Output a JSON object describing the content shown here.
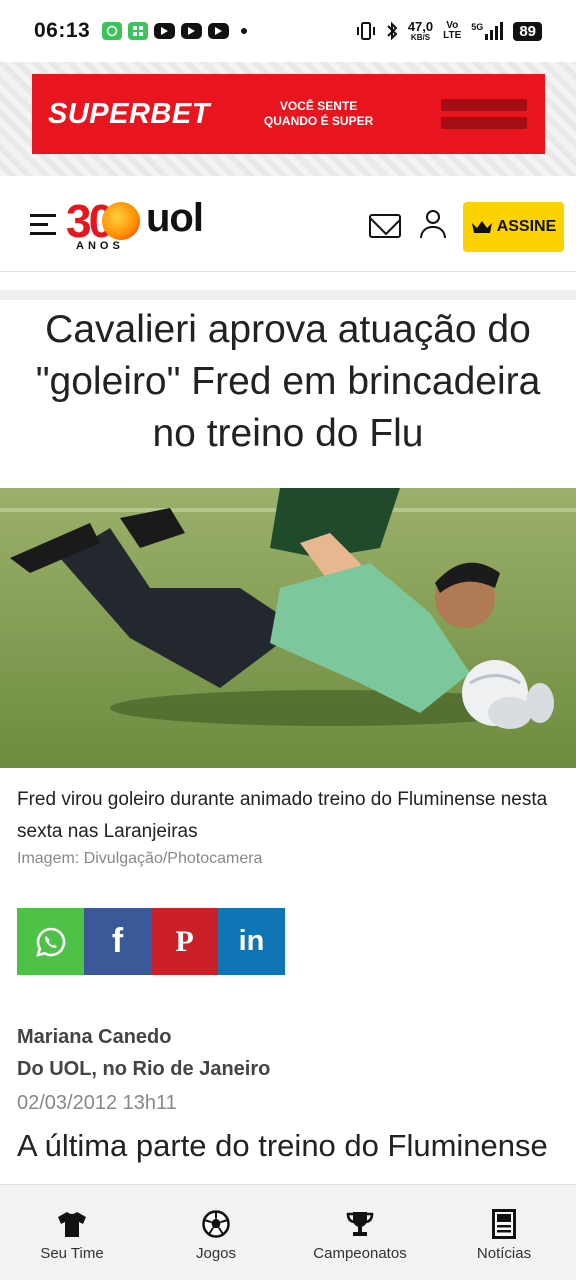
{
  "status_bar": {
    "time": "06:13",
    "speed_value": "47,0",
    "speed_unit": "KB/S",
    "network_top": "Vo",
    "network_bottom": "LTE",
    "signal_label": "5G",
    "battery": "89"
  },
  "ad": {
    "brand": "SUPERBET",
    "tagline_line1": "VOCÊ SENTE",
    "tagline_line2": "QUANDO É SUPER"
  },
  "header": {
    "logo_number": "30",
    "logo_brand": "uol",
    "logo_sub": "ANOS",
    "subscribe_label": "ASSINE"
  },
  "article": {
    "headline": "Cavalieri aprova atuação do \"goleiro\" Fred em brincadeira no treino do Flu",
    "caption": "Fred virou goleiro durante animado treino do Fluminense nesta sexta nas Laranjeiras",
    "credit": "Imagem: Divulgação/Photocamera",
    "author": "Mariana Canedo",
    "source": "Do UOL, no Rio de Janeiro",
    "date": "02/03/2012  13h11",
    "body_start": "A última parte do treino do Fluminense"
  },
  "share": [
    "whatsapp-icon",
    "facebook-icon",
    "pinterest-icon",
    "linkedin-icon"
  ],
  "bottom_nav": {
    "items": [
      {
        "label": "Seu Time",
        "icon": "shirt-icon"
      },
      {
        "label": "Jogos",
        "icon": "soccer-ball-icon"
      },
      {
        "label": "Campeonatos",
        "icon": "trophy-icon"
      },
      {
        "label": "Notícias",
        "icon": "newspaper-icon"
      }
    ]
  },
  "colors": {
    "ad_red": "#e8141e",
    "subscribe_yellow": "#fcd200",
    "whatsapp": "#4dc247",
    "facebook": "#3b5998",
    "pinterest": "#cb2027",
    "linkedin": "#1075b5"
  }
}
